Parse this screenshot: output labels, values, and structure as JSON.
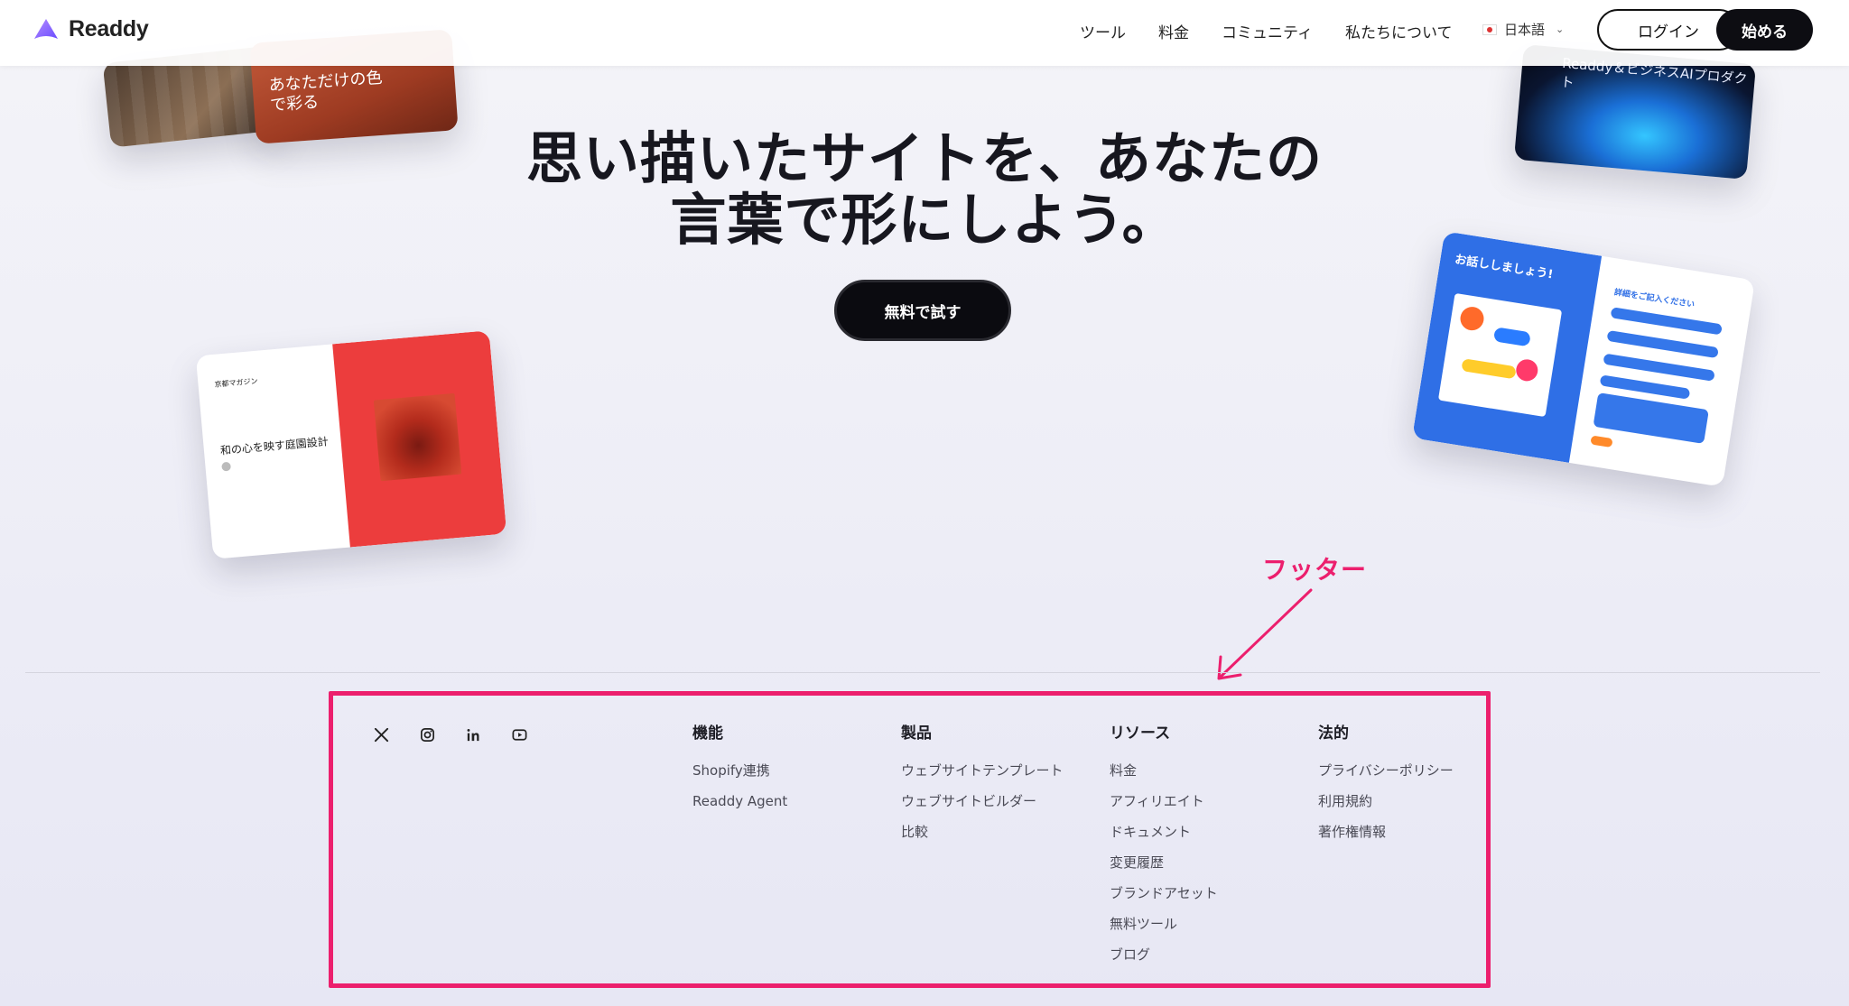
{
  "header": {
    "logo_text": "Readdy",
    "nav": [
      "ツール",
      "料金",
      "コミュニティ",
      "私たちについて"
    ],
    "language": "日本語",
    "login_label": "ログイン",
    "start_label": "始める"
  },
  "hero": {
    "title_line1": "思い描いたサイトを、あなたの",
    "title_line2": "言葉で形にしよう。",
    "cta_label": "無料で試す"
  },
  "previews": {
    "card_b_text_line1": "あなただけの色",
    "card_b_text_line2": "で彩る",
    "card_c_text": "Readdy＆ビジネスAIプロダクト",
    "card_d_brand": "京都マガジン",
    "card_d_headline": "和の心を映す庭園設計",
    "card_e_title": "お話ししましょう!",
    "card_e_form_title": "詳細をご記入ください"
  },
  "annotation": {
    "label": "フッター",
    "color": "#ec1f6d"
  },
  "footer": {
    "socials": [
      "x-icon",
      "instagram-icon",
      "linkedin-icon",
      "youtube-icon"
    ],
    "columns": [
      {
        "title": "機能",
        "links": [
          "Shopify連携",
          "Readdy Agent"
        ]
      },
      {
        "title": "製品",
        "links": [
          "ウェブサイトテンプレート",
          "ウェブサイトビルダー",
          "比較"
        ]
      },
      {
        "title": "リソース",
        "links": [
          "料金",
          "アフィリエイト",
          "ドキュメント",
          "変更履歴",
          "ブランドアセット",
          "無料ツール",
          "ブログ"
        ]
      },
      {
        "title": "法的",
        "links": [
          "プライバシーポリシー",
          "利用規約",
          "著作権情報"
        ]
      }
    ]
  }
}
